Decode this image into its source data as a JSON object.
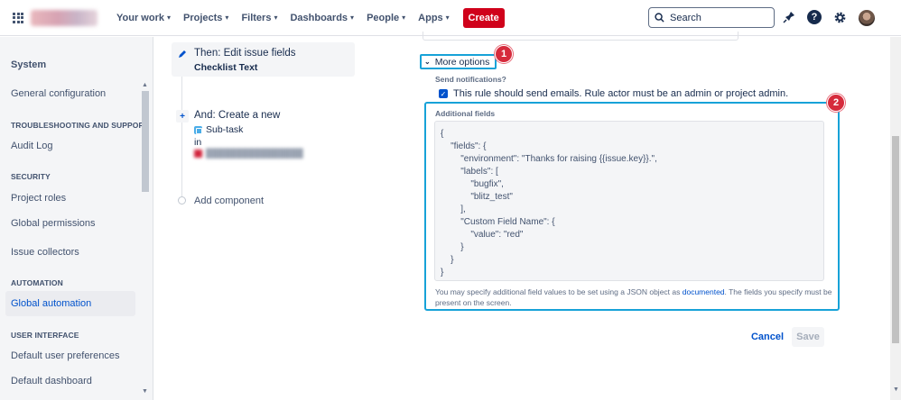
{
  "topnav": {
    "items": [
      {
        "label": "Your work"
      },
      {
        "label": "Projects"
      },
      {
        "label": "Filters"
      },
      {
        "label": "Dashboards"
      },
      {
        "label": "People"
      },
      {
        "label": "Apps"
      }
    ],
    "create_label": "Create",
    "search_placeholder": "Search",
    "icons": [
      "app-switcher-icon",
      "notifications-icon",
      "help-icon",
      "settings-icon",
      "avatar"
    ]
  },
  "sidebar": {
    "title": "System",
    "items": [
      {
        "type": "link",
        "label": "General configuration"
      },
      {
        "type": "heading",
        "label": "TROUBLESHOOTING AND SUPPORT"
      },
      {
        "type": "link",
        "label": "Audit Log"
      },
      {
        "type": "heading",
        "label": "SECURITY"
      },
      {
        "type": "link",
        "label": "Project roles"
      },
      {
        "type": "link",
        "label": "Global permissions"
      },
      {
        "type": "link",
        "label": "Issue collectors"
      },
      {
        "type": "heading",
        "label": "AUTOMATION"
      },
      {
        "type": "link",
        "label": "Global automation",
        "active": true
      },
      {
        "type": "heading",
        "label": "USER INTERFACE"
      },
      {
        "type": "link",
        "label": "Default user preferences"
      },
      {
        "type": "link",
        "label": "Default dashboard"
      }
    ]
  },
  "rule": {
    "then_title": "Then: Edit issue fields",
    "then_sub": "Checklist Text",
    "and_title": "And: Create a new",
    "and_type": "Sub-task",
    "and_in": "in",
    "add_component": "Add component"
  },
  "form": {
    "more_options": "More options",
    "send_notifications_label": "Send notifications?",
    "checkbox_label": "This rule should send emails. Rule actor must be an admin or project admin.",
    "checkbox_checked": true,
    "additional_fields_label": "Additional fields",
    "json_lines": [
      "{",
      "    \"fields\": {",
      "        \"environment\": \"Thanks for raising {{issue.key}}.\",",
      "        \"labels\": [",
      "            \"bugfix\",",
      "            \"blitz_test\"",
      "        ],",
      "        \"Custom Field Name\": {",
      "            \"value\": \"red\"",
      "        }",
      "    }",
      "}"
    ],
    "help_pre": "You may specify additional field values to be set using a JSON object as ",
    "help_link": "documented",
    "help_post": ". The fields you specify must be present on the screen.",
    "cancel_label": "Cancel",
    "save_label": "Save"
  },
  "annotations": {
    "badge_1": "1",
    "badge_2": "2"
  },
  "colors": {
    "create": "#d0021b",
    "highlight": "#17a2d8",
    "badge": "#d62b3c",
    "link": "#0052cc"
  }
}
